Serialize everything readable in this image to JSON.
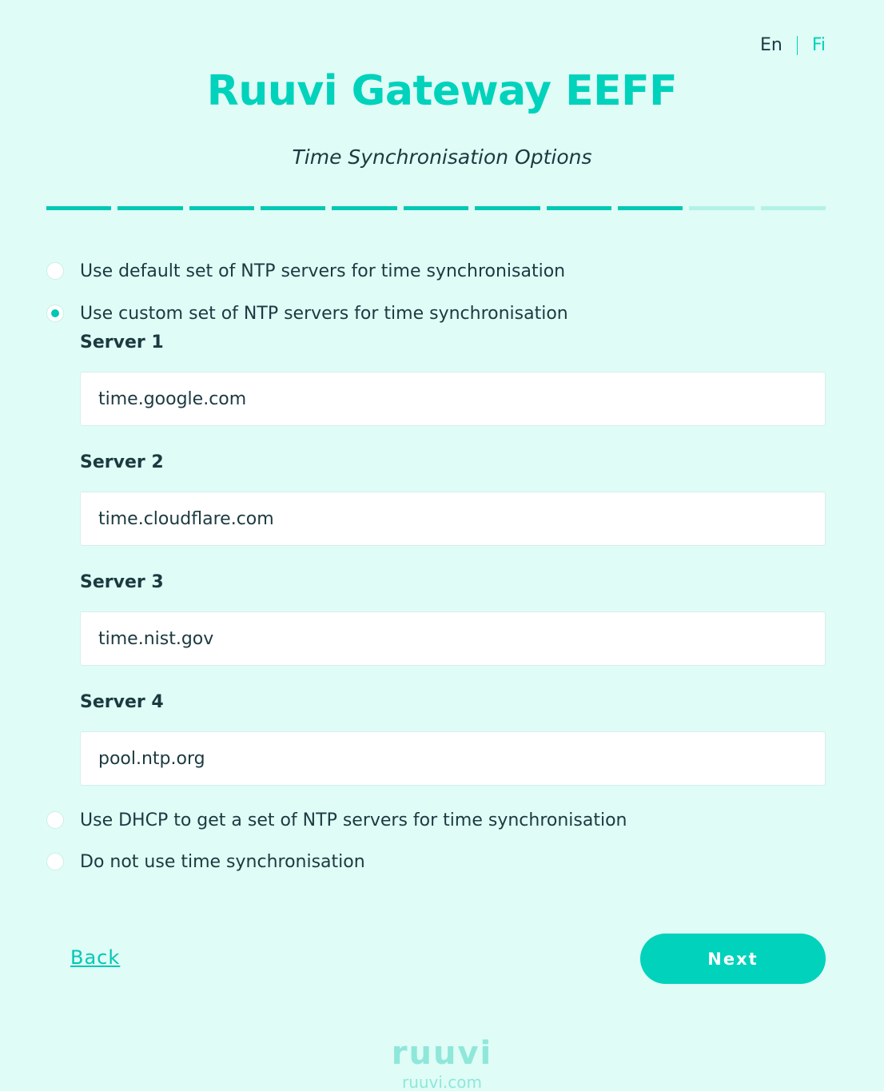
{
  "language": {
    "en": "En",
    "fi": "Fi",
    "active": "En"
  },
  "header": {
    "title": "Ruuvi Gateway EEFF",
    "subtitle": "Time Synchronisation Options"
  },
  "progress": {
    "completed_steps": 9,
    "total_steps": 11
  },
  "options": {
    "default": "Use default set of NTP servers for time synchronisation",
    "custom": "Use custom set of NTP servers for time synchronisation",
    "dhcp": "Use DHCP to get a set of NTP servers for time synchronisation",
    "none": "Do not use time synchronisation",
    "selected": "custom"
  },
  "servers": [
    {
      "label": "Server 1",
      "value": "time.google.com"
    },
    {
      "label": "Server 2",
      "value": "time.cloudflare.com"
    },
    {
      "label": "Server 3",
      "value": "time.nist.gov"
    },
    {
      "label": "Server 4",
      "value": "pool.ntp.org"
    }
  ],
  "footer": {
    "back_label": "Back",
    "next_label": "Next",
    "logo_text": "ruuvi",
    "logo_url": "ruuvi.com"
  },
  "colors": {
    "accent": "#00d2bb",
    "background": "#dffcf6",
    "text": "#1b3a40",
    "progress_inactive": "#b2f2e6"
  }
}
